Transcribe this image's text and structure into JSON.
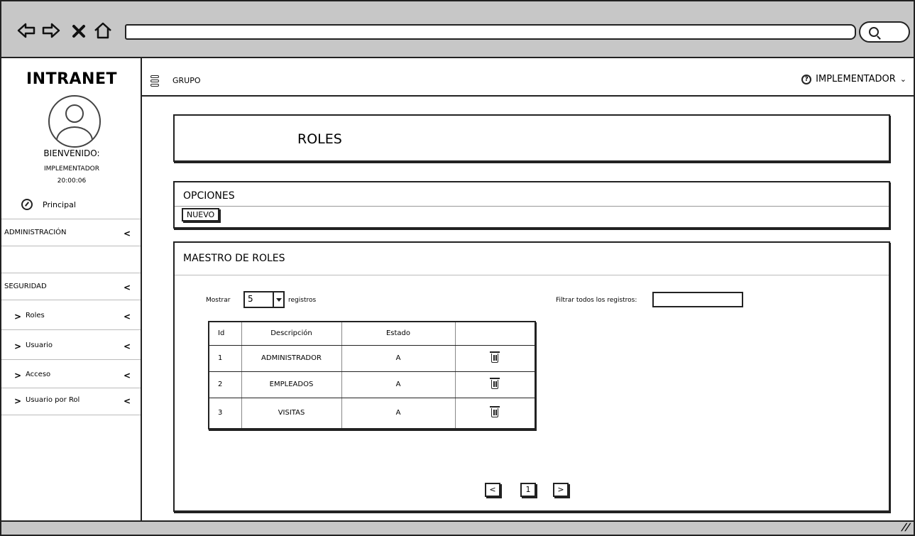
{
  "browser": {
    "icons": [
      "back-arrow-icon",
      "forward-arrow-icon",
      "close-icon",
      "home-icon",
      "search-icon"
    ]
  },
  "sidebar": {
    "brand": "INTRANET",
    "welcome_label": "BIENVENIDO:",
    "user": "IMPLEMENTADOR",
    "time": "20:00:06",
    "principal": "Principal",
    "items": [
      {
        "label": "ADMINISTRACIÓN"
      },
      {
        "label": "SEGURIDAD"
      },
      {
        "label": "Roles"
      },
      {
        "label": "Usuario"
      },
      {
        "label": "Acceso"
      },
      {
        "label": "Usuario por Rol"
      }
    ]
  },
  "topbar": {
    "group": "GRUPO",
    "user_menu": "IMPLEMENTADOR"
  },
  "main": {
    "title": "ROLES",
    "options_title": "OPCIONES",
    "new_button": "NUEVO",
    "master_title": "MAESTRO DE ROLES",
    "show_label": "Mostrar",
    "show_value": "5",
    "records_label": "registros",
    "filter_label": "Filtrar todos los registros:",
    "table": {
      "headers": [
        "Id",
        "Descripción",
        "Estado",
        ""
      ],
      "rows": [
        {
          "id": "1",
          "desc": "ADMINISTRADOR",
          "estado": "A"
        },
        {
          "id": "2",
          "desc": "EMPLEADOS",
          "estado": "A"
        },
        {
          "id": "3",
          "desc": "VISITAS",
          "estado": "A"
        }
      ]
    },
    "pagination": {
      "prev": "<",
      "page": "1",
      "next": ">"
    }
  }
}
